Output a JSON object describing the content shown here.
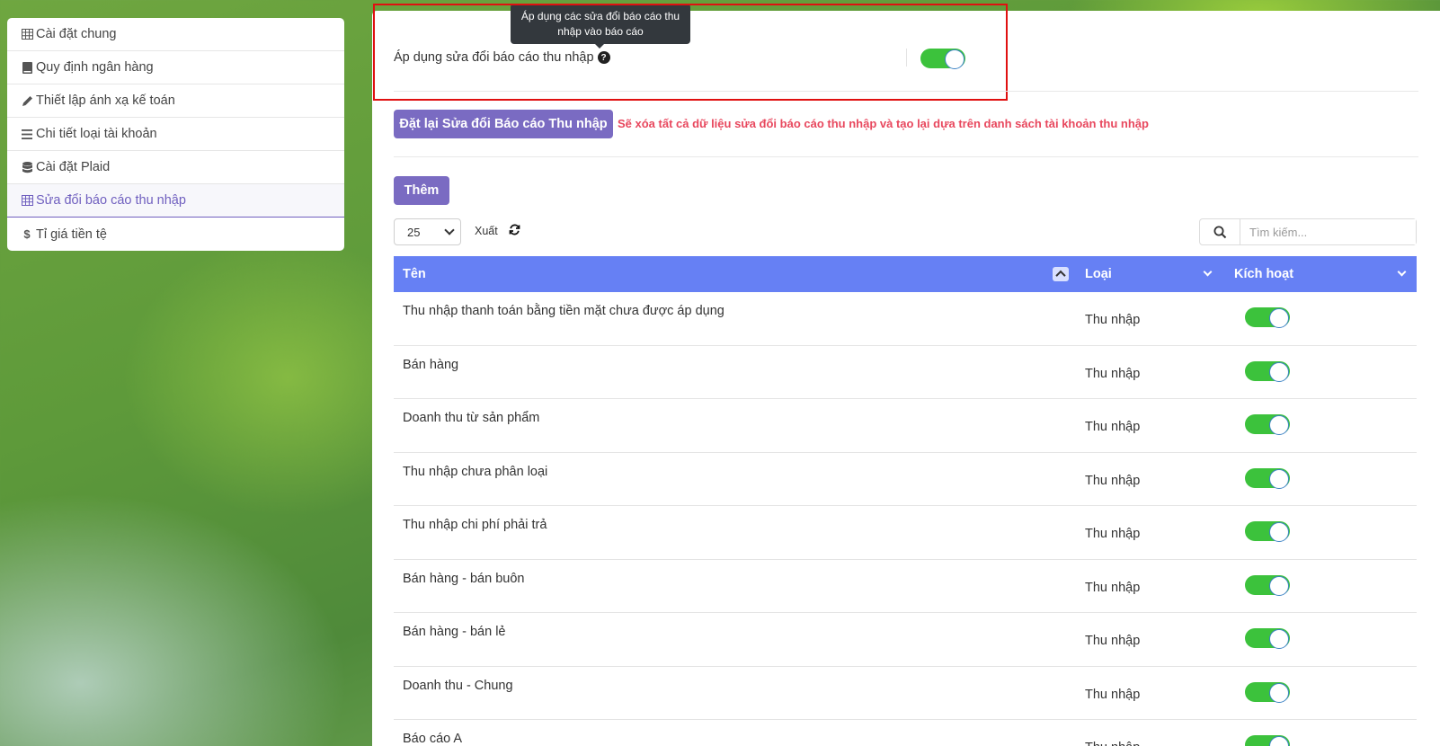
{
  "sidebar": {
    "items": [
      {
        "icon": "table-icon",
        "label": "Cài đặt chung"
      },
      {
        "icon": "book-icon",
        "label": "Quy định ngân hàng"
      },
      {
        "icon": "pencil-icon",
        "label": "Thiết lập ánh xạ kế toán"
      },
      {
        "icon": "list-icon",
        "label": "Chi tiết loại tài khoản"
      },
      {
        "icon": "database-icon",
        "label": "Cài đặt Plaid"
      },
      {
        "icon": "table-icon",
        "label": "Sửa đổi báo cáo thu nhập"
      },
      {
        "icon": "dollar-icon",
        "label": "Tỉ giá tiền tệ"
      }
    ],
    "active_index": 5
  },
  "settings": {
    "apply_label": "Áp dụng sửa đổi báo cáo thu nhập",
    "tooltip": "Áp dụng các sửa đổi báo cáo thu nhập vào báo cáo",
    "apply_enabled": true
  },
  "reset": {
    "button_label": "Đặt lại Sửa đổi Báo cáo Thu nhập",
    "warning": "Sẽ xóa tất cả dữ liệu sửa đổi báo cáo thu nhập và tạo lại dựa trên danh sách tài khoản thu nhập"
  },
  "toolbar": {
    "add_label": "Thêm",
    "page_size": "25",
    "export_label": "Xuất",
    "search_placeholder": "Tìm kiếm..."
  },
  "table": {
    "columns": [
      "Tên",
      "Loại",
      "Kích hoạt"
    ],
    "rows": [
      {
        "name": "Thu nhập thanh toán bằng tiền mặt chưa được áp dụng",
        "type": "Thu nhập",
        "active": true
      },
      {
        "name": "Bán hàng",
        "type": "Thu nhập",
        "active": true
      },
      {
        "name": "Doanh thu từ sản phẩm",
        "type": "Thu nhập",
        "active": true
      },
      {
        "name": "Thu nhập chưa phân loại",
        "type": "Thu nhập",
        "active": true
      },
      {
        "name": "Thu nhập chi phí phải trả",
        "type": "Thu nhập",
        "active": true
      },
      {
        "name": "Bán hàng - bán buôn",
        "type": "Thu nhập",
        "active": true
      },
      {
        "name": "Bán hàng - bán lẻ",
        "type": "Thu nhập",
        "active": true
      },
      {
        "name": "Doanh thu - Chung",
        "type": "Thu nhập",
        "active": true
      },
      {
        "name": "Báo cáo A",
        "type": "Thu nhập",
        "active": true
      }
    ]
  },
  "colors": {
    "accent": "#7a6bc2",
    "table_header": "#6680f4",
    "toggle_on": "#3cc23c",
    "warning": "#e8485e",
    "highlight": "#e01010"
  }
}
